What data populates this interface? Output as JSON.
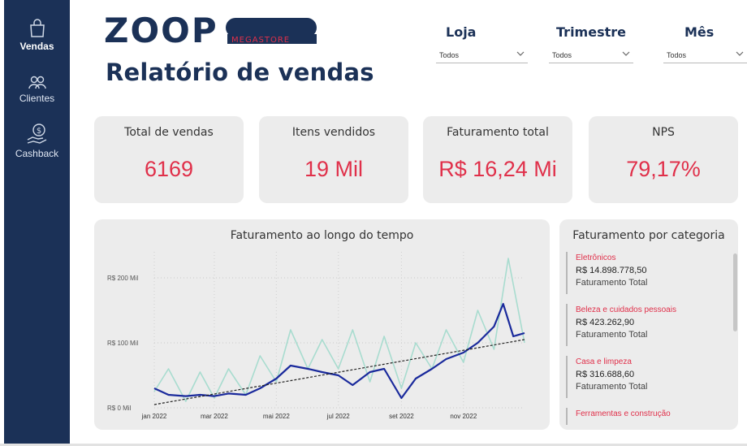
{
  "sidebar": {
    "items": [
      {
        "label": "Vendas",
        "icon": "shopping-bag-icon",
        "active": true
      },
      {
        "label": "Clientes",
        "icon": "users-icon",
        "active": false
      },
      {
        "label": "Cashback",
        "icon": "money-hand-icon",
        "active": false
      }
    ]
  },
  "header": {
    "logo_text": "ZOOP",
    "logo_sub": "MEGASTORE",
    "title": "Relatório de vendas"
  },
  "filters": [
    {
      "label": "Loja",
      "value": "Todos"
    },
    {
      "label": "Trimestre",
      "value": "Todos"
    },
    {
      "label": "Mês",
      "value": "Todos"
    }
  ],
  "kpis": [
    {
      "label": "Total de vendas",
      "value": "6169"
    },
    {
      "label": "Itens vendidos",
      "value": "19 Mil"
    },
    {
      "label": "Faturamento total",
      "value": "R$ 16,24 Mi"
    },
    {
      "label": "NPS",
      "value": "79,17%"
    }
  ],
  "line_chart": {
    "title": "Faturamento ao longo do tempo",
    "y_ticks": [
      "R$ 200 Mil",
      "R$ 100 Mil",
      "R$ 0 Mil"
    ],
    "x_ticks": [
      "jan 2022",
      "mar 2022",
      "mai 2022",
      "jul 2022",
      "set 2022",
      "nov 2022"
    ]
  },
  "categories": {
    "title": "Faturamento por categoria",
    "items": [
      {
        "name": "Eletrônicos",
        "value": "R$ 14.898.778,50",
        "sub": "Faturamento Total"
      },
      {
        "name": "Beleza e cuidados pessoais",
        "value": "R$ 423.262,90",
        "sub": "Faturamento Total"
      },
      {
        "name": "Casa e limpeza",
        "value": "R$ 316.688,60",
        "sub": "Faturamento Total"
      },
      {
        "name": "Ferramentas e construção",
        "value": "",
        "sub": ""
      }
    ]
  },
  "colors": {
    "sidebar": "#1b3157",
    "accent": "#e0304a",
    "card": "#ececec",
    "daily_line": "#a8dccf",
    "avg_line": "#1a2a9c",
    "trend_line": "#222222"
  },
  "chart_data": {
    "type": "line",
    "title": "Faturamento ao longo do tempo",
    "x_range": [
      "2022-01-01",
      "2022-12-31"
    ],
    "ylim": [
      0,
      240000
    ],
    "y_unit": "R$",
    "grid": true,
    "series": [
      {
        "style": "daily",
        "x": [
          "2022-01-01",
          "2022-01-15",
          "2022-02-01",
          "2022-02-15",
          "2022-03-01",
          "2022-03-15",
          "2022-04-01",
          "2022-04-15",
          "2022-05-01",
          "2022-05-15",
          "2022-06-01",
          "2022-06-15",
          "2022-07-01",
          "2022-07-15",
          "2022-08-01",
          "2022-08-15",
          "2022-09-01",
          "2022-09-15",
          "2022-10-01",
          "2022-10-15",
          "2022-11-01",
          "2022-11-15",
          "2022-12-01",
          "2022-12-15",
          "2022-12-31"
        ],
        "y": [
          25000,
          60000,
          10000,
          55000,
          15000,
          60000,
          20000,
          80000,
          40000,
          120000,
          60000,
          105000,
          60000,
          120000,
          40000,
          110000,
          30000,
          100000,
          60000,
          120000,
          70000,
          150000,
          90000,
          230000,
          100000
        ]
      },
      {
        "style": "moving_average",
        "x": [
          "2022-01-01",
          "2022-01-15",
          "2022-02-01",
          "2022-02-15",
          "2022-03-01",
          "2022-03-15",
          "2022-04-01",
          "2022-04-15",
          "2022-05-01",
          "2022-05-15",
          "2022-06-01",
          "2022-06-15",
          "2022-07-01",
          "2022-07-15",
          "2022-08-01",
          "2022-08-15",
          "2022-09-01",
          "2022-09-15",
          "2022-10-01",
          "2022-10-15",
          "2022-11-01",
          "2022-11-15",
          "2022-12-01",
          "2022-12-10",
          "2022-12-20",
          "2022-12-31"
        ],
        "y": [
          30000,
          20000,
          18000,
          20000,
          18000,
          22000,
          20000,
          30000,
          45000,
          65000,
          60000,
          55000,
          50000,
          35000,
          55000,
          60000,
          15000,
          45000,
          60000,
          75000,
          85000,
          100000,
          125000,
          160000,
          110000,
          115000
        ]
      },
      {
        "style": "trend",
        "x": [
          "2022-01-01",
          "2022-12-31"
        ],
        "y": [
          5000,
          105000
        ]
      }
    ]
  }
}
